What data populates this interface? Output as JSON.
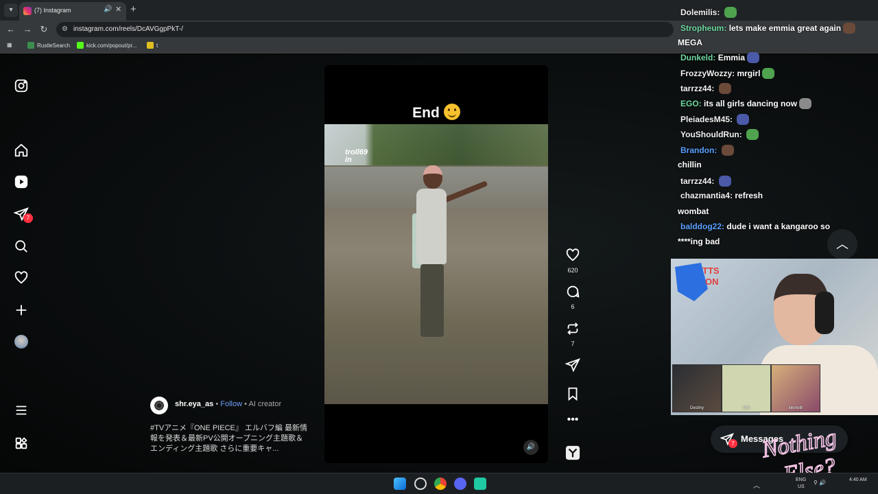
{
  "browser": {
    "tab_title": "(7) Instagram",
    "url": "instagram.com/reels/DcAVGgpPkT-/",
    "bookmarks": [
      {
        "label": "RustleSearch"
      },
      {
        "label": "kick.com/popout/pr..."
      },
      {
        "label": "t"
      }
    ]
  },
  "sidebar": {
    "notification_count": "7"
  },
  "reel": {
    "overlay_text": "End",
    "watermark": "troll69 in",
    "author": "shr.eya_as",
    "separator": "•",
    "follow_label": "Follow",
    "author_tag": "AI creator",
    "caption": "#TVアニメ『ONE PIECE』 エルバフ編 最新情報を発表＆最新PV公開オープニング主題歌＆エンディング主題歌 さらに重要キャ...",
    "likes": "620",
    "comments": "6",
    "reposts": "7"
  },
  "chat": {
    "lines": [
      {
        "user": "Dolemilis:",
        "text": "",
        "color": "#f2f2f2"
      },
      {
        "user": "Stropheum:",
        "text": "lets make emmia great again",
        "color": "#6fd9a0"
      },
      {
        "user": "",
        "text": "MEGA",
        "color": "#f2f2f2"
      },
      {
        "user": "Dunkeld:",
        "text": "Emmia",
        "color": "#6fd9a0"
      },
      {
        "user": "FrozzyWozzy:",
        "text": "mrgirl",
        "color": "#f2f2f2"
      },
      {
        "user": "tarrzz44:",
        "text": "",
        "color": "#f2f2f2"
      },
      {
        "user": "EGO:",
        "text": "its all girls dancing now",
        "color": "#6fd9a0"
      },
      {
        "user": "PleiadesM45:",
        "text": "",
        "color": "#f2f2f2"
      },
      {
        "user": "YouShouldRun:",
        "text": "",
        "color": "#f2f2f2"
      },
      {
        "user": "Brandon:",
        "text": "",
        "color": "#5aa0ff"
      },
      {
        "user": "",
        "text": "chillin",
        "color": "#f2f2f2"
      },
      {
        "user": "tarrzz44:",
        "text": "",
        "color": "#f2f2f2"
      },
      {
        "user": "chazmantia4:",
        "text": "refresh",
        "color": "#f2f2f2"
      },
      {
        "user": "",
        "text": "wombat",
        "color": "#f2f2f2"
      },
      {
        "user": "balddog22:",
        "text": "dude i want a kangaroo so",
        "color": "#5aa0ff"
      },
      {
        "user": "",
        "text": "****ing bad",
        "color": "#f2f2f2"
      }
    ]
  },
  "webcam": {
    "sign_text_1": "TTS",
    "sign_text_2": "ON",
    "tiles": [
      {
        "label": "Destiny"
      },
      {
        "label": "emi"
      },
      {
        "label": "inkmoth"
      }
    ]
  },
  "messages": {
    "label": "Messages",
    "badge": "7"
  },
  "overlay_logo": {
    "line1": "Nothing",
    "line2": "Else?"
  },
  "taskbar": {
    "lang_1": "ENG",
    "lang_2": "US",
    "time": "4:40 AM"
  },
  "colors": {
    "accent_blue": "#6f9cf7",
    "notification_red": "#ff3040"
  }
}
